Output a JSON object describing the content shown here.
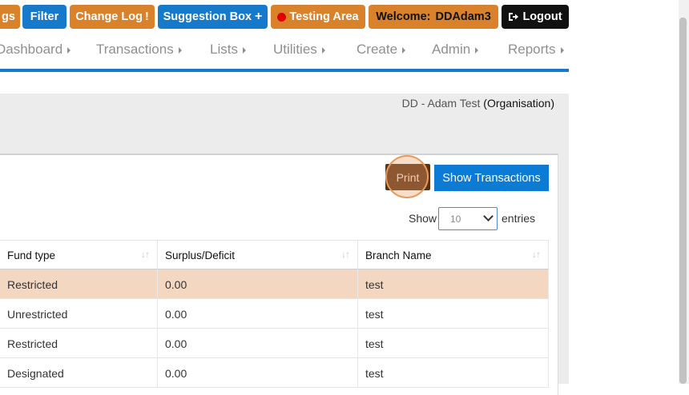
{
  "topbar": {
    "settings_partial": "gs",
    "filter": "Filter",
    "changelog": "Change Log",
    "changelog_mark": "!",
    "suggestion": "Suggestion Box",
    "suggestion_mark": "+",
    "testing": "Testing Area",
    "welcome": "Welcome:",
    "user": "DDAdam3",
    "logout": "Logout"
  },
  "nav": [
    "Dashboard",
    "Transactions",
    "Lists",
    "Utilities",
    "Create",
    "Admin",
    "Reports"
  ],
  "org": {
    "name": "DD - Adam Test",
    "type": "(Organisation)"
  },
  "actions": {
    "print": "Print",
    "show_transactions": "Show Transactions"
  },
  "length": {
    "show": "Show",
    "value": "10",
    "entries": "entries"
  },
  "table": {
    "headers": [
      "Fund type",
      "Surplus/Deficit",
      "Branch Name"
    ],
    "rows": [
      [
        "Restricted",
        "0.00",
        "test"
      ],
      [
        "Unrestricted",
        "0.00",
        "test"
      ],
      [
        "Restricted",
        "0.00",
        "test"
      ],
      [
        "Designated",
        "0.00",
        "test"
      ]
    ]
  },
  "colors": {
    "orange": "#d9822b",
    "blue": "#1779c9",
    "print": "#5b3216",
    "highlight": "#f4d7c1"
  }
}
